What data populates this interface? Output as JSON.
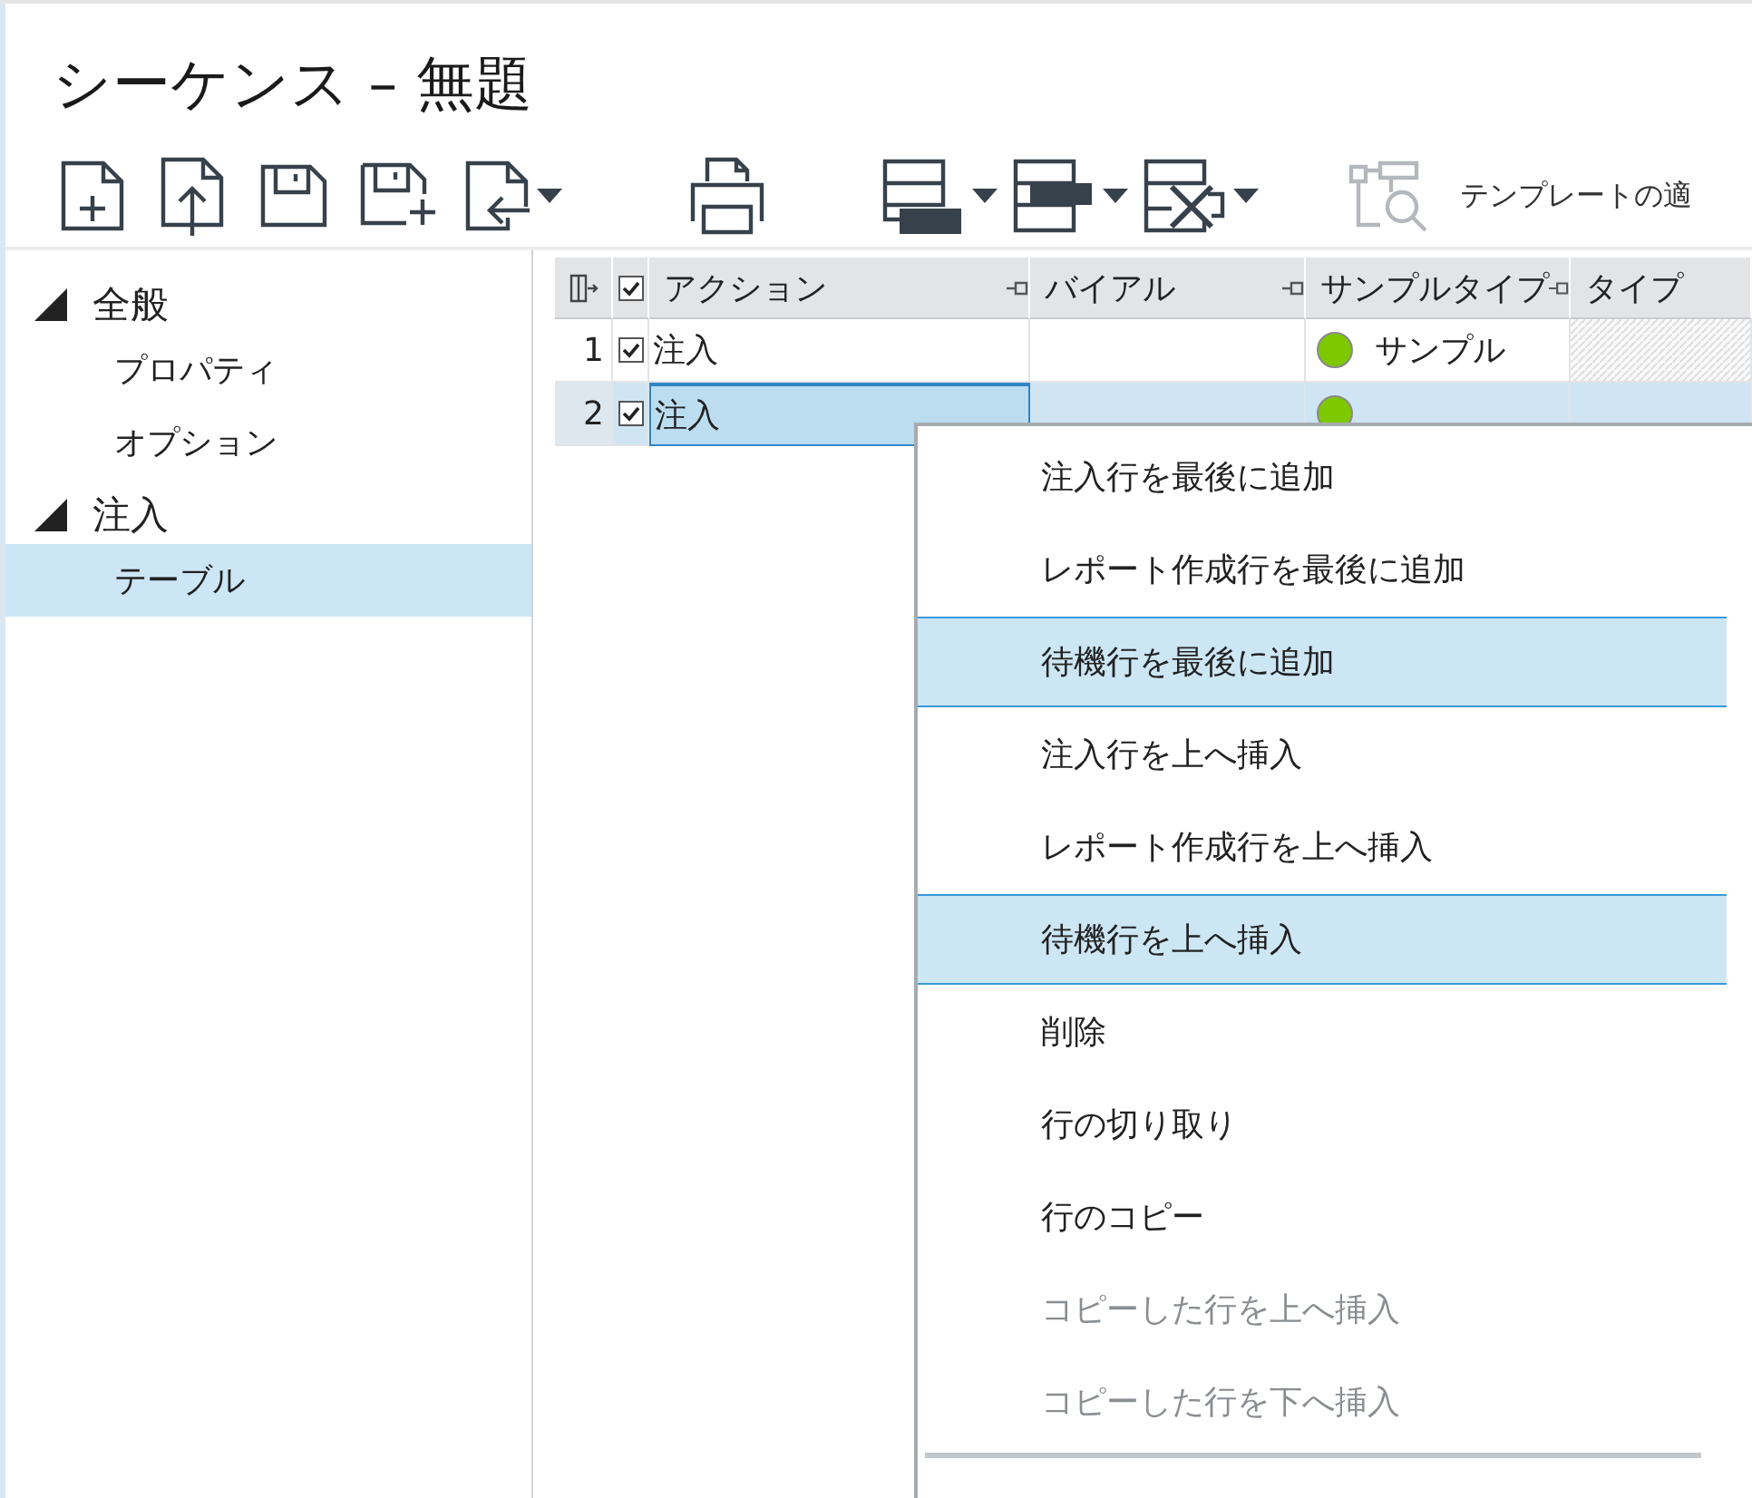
{
  "window": {
    "title": "シーケンス – 無題"
  },
  "toolbar": {
    "buttons": [
      {
        "kind": "new",
        "dropdown": false,
        "disabled": false
      },
      {
        "kind": "open",
        "dropdown": false,
        "disabled": false
      },
      {
        "kind": "save",
        "dropdown": false,
        "disabled": false
      },
      {
        "kind": "saveas",
        "dropdown": false,
        "disabled": false
      },
      {
        "kind": "import",
        "dropdown": true,
        "disabled": false
      },
      {
        "kind": "print",
        "dropdown": false,
        "disabled": false
      },
      {
        "kind": "rowbottom",
        "dropdown": true,
        "disabled": false
      },
      {
        "kind": "rowmiddle",
        "dropdown": true,
        "disabled": false
      },
      {
        "kind": "rowdelete",
        "dropdown": true,
        "disabled": false
      },
      {
        "kind": "template",
        "dropdown": false,
        "disabled": true,
        "label": "テンプレートの適"
      }
    ]
  },
  "sidebar": {
    "items": [
      {
        "label": "全般",
        "expanded": true,
        "children": [
          {
            "label": "プロパティ",
            "selected": false
          },
          {
            "label": "オプション",
            "selected": false
          }
        ]
      },
      {
        "label": "注入",
        "expanded": true,
        "children": [
          {
            "label": "テーブル",
            "selected": true
          }
        ]
      }
    ]
  },
  "table": {
    "header_checked": true,
    "columns": [
      {
        "label": "アクション",
        "pinned": true
      },
      {
        "label": "バイアル",
        "pinned": true
      },
      {
        "label": "サンプルタイプ",
        "pinned": true
      },
      {
        "label": "タイプ",
        "pinned": false
      }
    ],
    "rows": [
      {
        "number": "1",
        "checked": true,
        "selected": false,
        "action": "注入",
        "sample_type": "サンプル",
        "color": "#7ec800"
      },
      {
        "number": "2",
        "checked": true,
        "selected": true,
        "action": "注入",
        "color": "#7ec800"
      }
    ]
  },
  "context_menu": {
    "items": [
      {
        "label": "注入行を最後に追加",
        "selected": false,
        "disabled": false
      },
      {
        "label": "レポート作成行を最後に追加",
        "selected": false,
        "disabled": false
      },
      {
        "label": "待機行を最後に追加",
        "selected": true,
        "disabled": false
      },
      {
        "label": "注入行を上へ挿入",
        "selected": false,
        "disabled": false
      },
      {
        "label": "レポート作成行を上へ挿入",
        "selected": false,
        "disabled": false
      },
      {
        "label": "待機行を上へ挿入",
        "selected": true,
        "disabled": false
      },
      {
        "label": "削除",
        "selected": false,
        "disabled": false
      },
      {
        "label": "行の切り取り",
        "selected": false,
        "disabled": false
      },
      {
        "label": "行のコピー",
        "selected": false,
        "disabled": false
      },
      {
        "label": "コピーした行を上へ挿入",
        "selected": false,
        "disabled": true
      },
      {
        "label": "コピーした行を下へ挿入",
        "selected": false,
        "disabled": true
      }
    ]
  }
}
